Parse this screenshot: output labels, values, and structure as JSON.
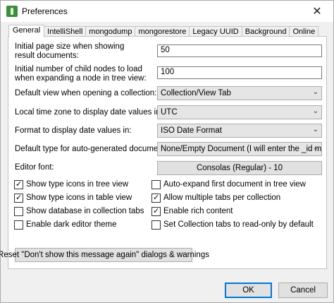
{
  "window": {
    "title": "Preferences",
    "close_glyph": "✕"
  },
  "tabs": [
    "General",
    "IntelliShell",
    "mongodump",
    "mongorestore",
    "Legacy UUID",
    "Background",
    "Online"
  ],
  "general": {
    "initial_page_size": {
      "label_line1": "Initial page size when showing",
      "label_line2": "result documents:",
      "value": "50"
    },
    "child_nodes": {
      "label_line1": "Initial number of child nodes to load",
      "label_line2": "when expanding a node in tree view:",
      "value": "100"
    },
    "default_view": {
      "label": "Default view when opening a collection:",
      "value": "Collection/View Tab"
    },
    "time_zone": {
      "label": "Local time zone to display date values in:",
      "value": "UTC"
    },
    "date_format": {
      "label": "Format to display date values in:",
      "value": "ISO Date Format"
    },
    "id_type": {
      "label": "Default type for auto-generated document _id:",
      "value": "None/Empty Document (I will enter the _id myself)"
    },
    "editor_font": {
      "label": "Editor font:",
      "value": "Consolas (Regular) - 10"
    },
    "checkboxes_left": [
      {
        "label": "Show type icons in tree view",
        "checked": true
      },
      {
        "label": "Show type icons in table view",
        "checked": true
      },
      {
        "label": "Show database in collection tabs",
        "checked": false
      },
      {
        "label": "Enable dark editor theme",
        "checked": false
      }
    ],
    "checkboxes_right": [
      {
        "label": "Auto-expand first document in tree view",
        "checked": false
      },
      {
        "label": "Allow multiple tabs per collection",
        "checked": true
      },
      {
        "label": "Enable rich content",
        "checked": true
      },
      {
        "label": "Set Collection tabs to read-only by default",
        "checked": false
      }
    ],
    "reset_button": "Reset \"Don't show this message again\" dialogs & warnings"
  },
  "footer": {
    "ok": "OK",
    "cancel": "Cancel"
  }
}
